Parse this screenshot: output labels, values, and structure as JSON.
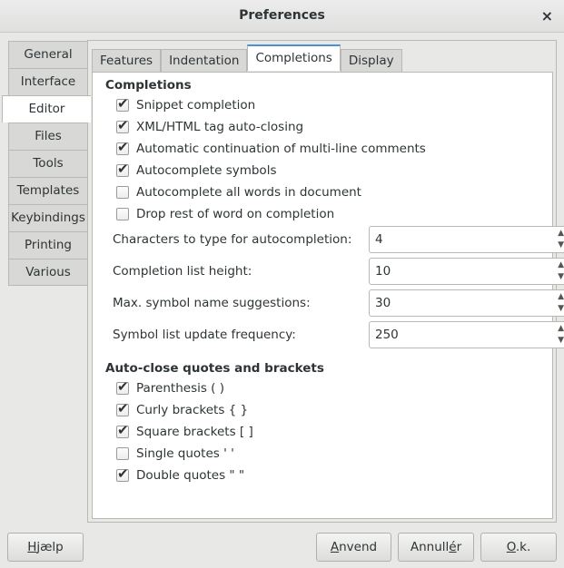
{
  "window": {
    "title": "Preferences",
    "close_glyph": "×"
  },
  "sidebar": {
    "tabs": [
      {
        "label": "General"
      },
      {
        "label": "Interface"
      },
      {
        "label": "Editor"
      },
      {
        "label": "Files"
      },
      {
        "label": "Tools"
      },
      {
        "label": "Templates"
      },
      {
        "label": "Keybindings"
      },
      {
        "label": "Printing"
      },
      {
        "label": "Various"
      }
    ],
    "active": "Editor"
  },
  "tabs": {
    "items": [
      {
        "label": "Features"
      },
      {
        "label": "Indentation"
      },
      {
        "label": "Completions"
      },
      {
        "label": "Display"
      }
    ],
    "active": "Completions"
  },
  "completions": {
    "section_title": "Completions",
    "options": [
      {
        "label": "Snippet completion",
        "checked": true
      },
      {
        "label": "XML/HTML tag auto-closing",
        "checked": true
      },
      {
        "label": "Automatic continuation of multi-line comments",
        "checked": true
      },
      {
        "label": "Autocomplete symbols",
        "checked": true
      },
      {
        "label": "Autocomplete all words in document",
        "checked": false
      },
      {
        "label": "Drop rest of word on completion",
        "checked": false
      }
    ],
    "spinners": [
      {
        "label": "Characters to type for autocompletion:",
        "value": "4"
      },
      {
        "label": "Completion list height:",
        "value": "10"
      },
      {
        "label": "Max. symbol name suggestions:",
        "value": "30"
      },
      {
        "label": "Symbol list update frequency:",
        "value": "250"
      }
    ]
  },
  "autoclose": {
    "section_title": "Auto-close quotes and brackets",
    "options": [
      {
        "label": "Parenthesis ( )",
        "checked": true
      },
      {
        "label": "Curly brackets { }",
        "checked": true
      },
      {
        "label": "Square brackets [ ]",
        "checked": true
      },
      {
        "label": "Single quotes ' '",
        "checked": false
      },
      {
        "label": "Double quotes \" \"",
        "checked": true
      }
    ]
  },
  "buttons": {
    "help": {
      "mnemonic": "H",
      "rest": "jælp"
    },
    "apply": {
      "mnemonic": "A",
      "rest": "nvend"
    },
    "cancel": {
      "pre": "Annull",
      "mnemonic": "é",
      "rest": "r"
    },
    "ok": {
      "pre": "",
      "mnemonic": "O",
      "rest": ".k."
    }
  },
  "icons": {
    "spin_up": "▲",
    "spin_down": "▼"
  },
  "colors": {
    "accent": "#4a90d9",
    "window_bg": "#e8e8e7",
    "content_bg": "#ffffff"
  }
}
